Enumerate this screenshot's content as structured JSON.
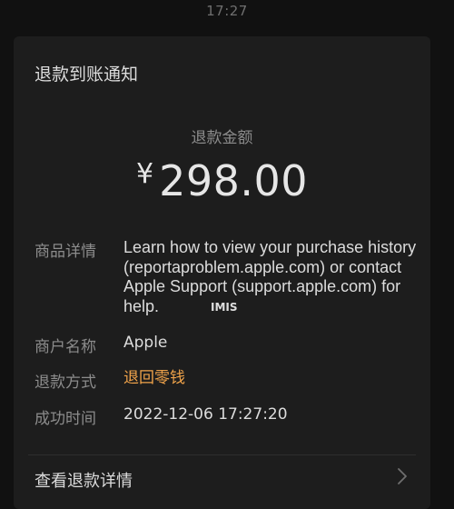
{
  "status": {
    "time": "17:27"
  },
  "card": {
    "title": "退款到账通知",
    "amount_label": "退款金额",
    "currency_symbol": "¥",
    "amount_value": "298.00",
    "rows": [
      {
        "label": "商品详情",
        "value": "Learn how to view your purchase history (reportaproblem.apple.com) or contact Apple Support (support.apple.com) for help."
      },
      {
        "label": "商户名称",
        "value": "Apple"
      },
      {
        "label": "退款方式",
        "value": "退回零钱"
      },
      {
        "label": "成功时间",
        "value": "2022-12-06 17:27:20"
      }
    ],
    "footer_label": "查看退款详情"
  },
  "watermark": "IMIS",
  "colors": {
    "background": "#111111",
    "card": "#1d1d1d",
    "accent_orange": "#f0a34a",
    "label_gray": "#8c8c8c"
  },
  "icons": {
    "footer": "chevron-right-icon"
  }
}
